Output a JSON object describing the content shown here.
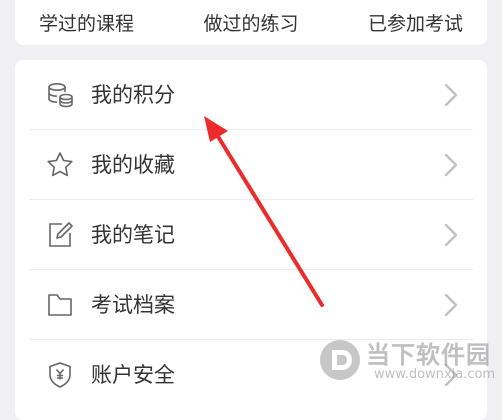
{
  "top_tabs": [
    "学过的课程",
    "做过的练习",
    "已参加考试"
  ],
  "menu": [
    {
      "label": "我的积分",
      "icon": "coins-icon"
    },
    {
      "label": "我的收藏",
      "icon": "star-icon"
    },
    {
      "label": "我的笔记",
      "icon": "edit-note-icon"
    },
    {
      "label": "考试档案",
      "icon": "folder-icon"
    },
    {
      "label": "账户安全",
      "icon": "shield-yen-icon"
    }
  ],
  "annotation": {
    "color": "#ee2b2b"
  },
  "watermark": {
    "title": "当下软件园",
    "url": "www.downxia.com"
  },
  "colors": {
    "background": "#f0f0f3",
    "card": "#ffffff",
    "text": "#333333",
    "icon": "#666666",
    "chevron": "#c2c2c2"
  }
}
